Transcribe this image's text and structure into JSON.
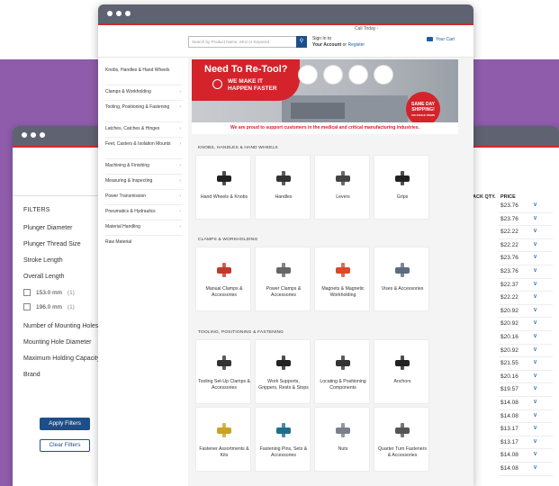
{
  "back_window": {
    "filters_title": "FILTERS",
    "filters": [
      "Plunger Diameter",
      "Plunger Thread Size",
      "Stroke Length",
      "Overall Length"
    ],
    "checkboxes": [
      {
        "label": "153.0 mm",
        "count": "(1)"
      },
      {
        "label": "196.0 mm",
        "count": "(1)"
      }
    ],
    "filters2": [
      "Number of Mounting Holes",
      "Mounting Hole Diameter",
      "Maximum Holding Capacity",
      "Brand"
    ],
    "apply_label": "Apply Filters",
    "clear_label": "Clear Filters",
    "col_pack": "ACK QTY.",
    "col_price": "PRICE",
    "prices": [
      "$23.76",
      "$23.76",
      "$22.22",
      "$22.22",
      "$23.76",
      "$23.76",
      "$22.37",
      "$22.22",
      "$20.92",
      "$20.92",
      "$20.16",
      "$20.92",
      "$21.55",
      "$20.16",
      "$19.57",
      "$14.08",
      "$14.08",
      "$13.17",
      "$13.17",
      "$14.08",
      "$14.08"
    ]
  },
  "front_window": {
    "call_today": "Call Today -",
    "search_placeholder": "Search by Product Name, SKU or Keyword",
    "account_line1": "Sign In to",
    "account_line2_a": "Your Account",
    "account_line2_or": " or ",
    "account_line2_reg": "Register",
    "cart": "Your Cart",
    "sidebar": [
      "Knobs, Handles & Hand Wheels",
      "Clamps & Workholding",
      "Tooling, Positioning & Fastening",
      "Latches, Catches & Hinges",
      "Feet, Casters & Isolation Mounts",
      "Machining & Finishing",
      "Measuring & Inspecting",
      "Power Transmission",
      "Pneumatics & Hydraulics",
      "Material Handling",
      "Raw Material"
    ],
    "banner": {
      "title": "Need To Re-Tool?",
      "sub1": "WE MAKE IT",
      "sub2": "HAPPEN FASTER",
      "badge1": "SAME DAY",
      "badge2": "SHIPPING!",
      "badge3": "ON STOCK ITEMS",
      "proud": "We are proud to support customers in the medical and critical manufacturing industries."
    },
    "sections": [
      {
        "title": "KNOBS, HANDLES & HAND WHEELS",
        "items": [
          "Hand Wheels & Knobs",
          "Handles",
          "Levers",
          "Grips"
        ]
      },
      {
        "title": "CLAMPS & WORKHOLDING",
        "items": [
          "Manual Clamps & Accessories",
          "Power Clamps & Accessories",
          "Magnets & Magnetic Workholding",
          "Vises & Accessories"
        ]
      },
      {
        "title": "TOOLING, POSITIONING & FASTENING",
        "items": [
          "Tooling Set-Up Clamps & Accessories",
          "Work Supports, Grippers, Rests & Stops",
          "Locating & Positioning Components",
          "Anchors"
        ]
      },
      {
        "title": "",
        "items": [
          "Fastener Assortments & Kits",
          "Fastening Pins, Sets & Accessories",
          "Nuts",
          "Quarter Turn Fasteners & Accessories"
        ]
      }
    ]
  }
}
